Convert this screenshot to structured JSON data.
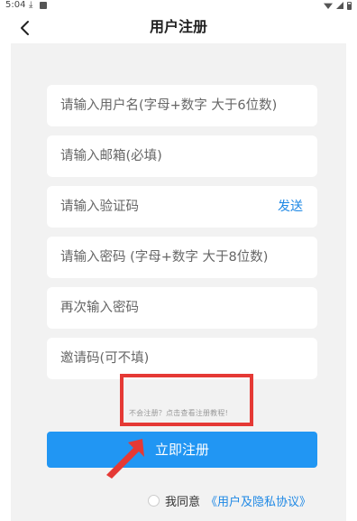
{
  "status_bar": {
    "time": "5:04",
    "icons": [
      "download-icon",
      "image-icon",
      "wifi-icon",
      "signal-icon",
      "battery-icon"
    ]
  },
  "header": {
    "title": "用户注册",
    "back_icon": "chevron-left-icon"
  },
  "form": {
    "username_placeholder": "请输入用户名(字母+数字 大于6位数)",
    "email_placeholder": "请输入邮箱(必填)",
    "code_placeholder": "请输入验证码",
    "send_label": "发送",
    "password_placeholder": "请输入密码 (字母+数字 大于8位数)",
    "password_confirm_placeholder": "再次输入密码",
    "invite_placeholder": "邀请码(可不填)"
  },
  "hint": "不会注册？点击查看注册教程!",
  "register_label": "立即注册",
  "agreement": {
    "prefix": "我同意",
    "link": "《用户及隐私协议》"
  },
  "colors": {
    "primary": "#2196f3",
    "link": "#1e88e5",
    "highlight": "#e53935",
    "background": "#f2f2f2"
  }
}
